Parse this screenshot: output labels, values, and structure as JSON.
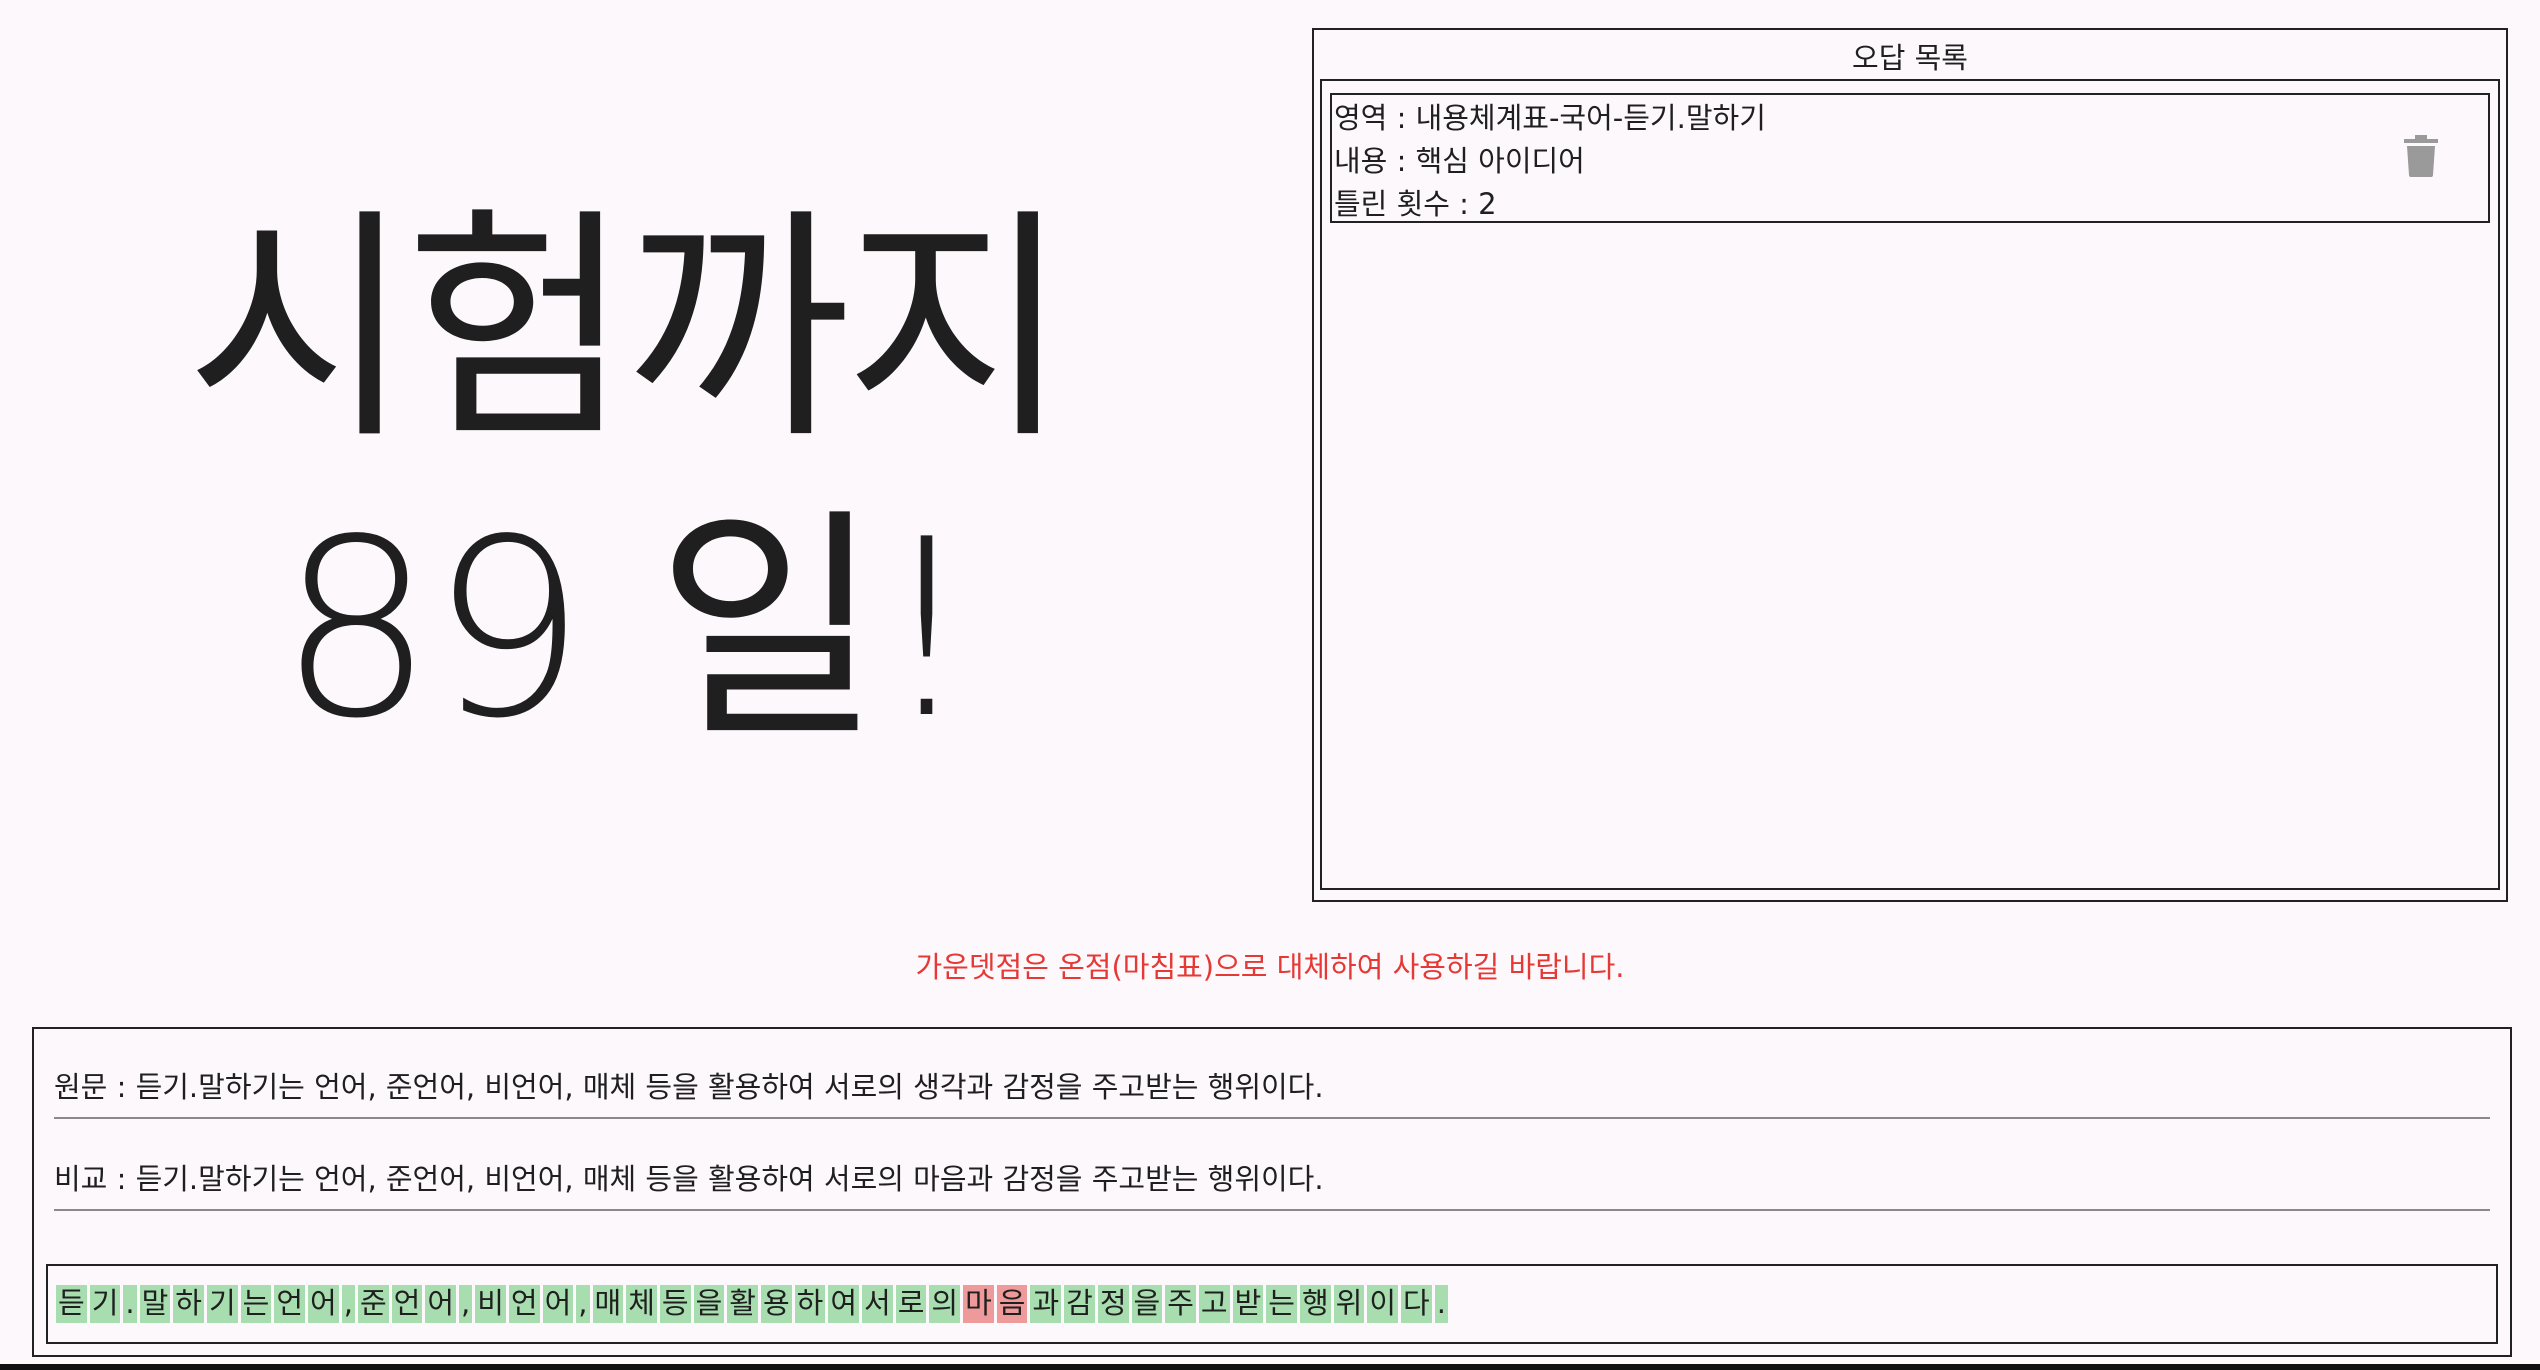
{
  "countdown": {
    "line1": "시험까지",
    "line2": "89 일!"
  },
  "wrong_answers": {
    "title": "오답 목록",
    "items": [
      {
        "area": "영역 : 내용체계표-국어-듣기.말하기",
        "content": "내용 : 핵심 아이디어",
        "wrong_count": "틀린 횟수 : 2",
        "delete_icon": "trash-icon"
      }
    ]
  },
  "notice": {
    "text": "가운뎃점은 온점(마침표)으로 대체하여 사용하길 바랍니다."
  },
  "compare": {
    "original": "원문 : 듣기.말하기는 언어, 준언어, 비언어, 매체 등을 활용하여 서로의 생각과 감정을 주고받는 행위이다.",
    "comparison": "비교 : 듣기.말하기는 언어, 준언어, 비언어, 매체 등을 활용하여 서로의 마음과 감정을 주고받는 행위이다.",
    "diff": [
      {
        "ch": "듣",
        "ok": true
      },
      {
        "ch": "기",
        "ok": true
      },
      {
        "ch": ".",
        "ok": true
      },
      {
        "ch": "말",
        "ok": true
      },
      {
        "ch": "하",
        "ok": true
      },
      {
        "ch": "기",
        "ok": true
      },
      {
        "ch": "는",
        "ok": true
      },
      {
        "ch": "언",
        "ok": true
      },
      {
        "ch": "어",
        "ok": true
      },
      {
        "ch": ",",
        "ok": true
      },
      {
        "ch": "준",
        "ok": true
      },
      {
        "ch": "언",
        "ok": true
      },
      {
        "ch": "어",
        "ok": true
      },
      {
        "ch": ",",
        "ok": true
      },
      {
        "ch": "비",
        "ok": true
      },
      {
        "ch": "언",
        "ok": true
      },
      {
        "ch": "어",
        "ok": true
      },
      {
        "ch": ",",
        "ok": true
      },
      {
        "ch": "매",
        "ok": true
      },
      {
        "ch": "체",
        "ok": true
      },
      {
        "ch": "등",
        "ok": true
      },
      {
        "ch": "을",
        "ok": true
      },
      {
        "ch": "활",
        "ok": true
      },
      {
        "ch": "용",
        "ok": true
      },
      {
        "ch": "하",
        "ok": true
      },
      {
        "ch": "여",
        "ok": true
      },
      {
        "ch": "서",
        "ok": true
      },
      {
        "ch": "로",
        "ok": true
      },
      {
        "ch": "의",
        "ok": true
      },
      {
        "ch": "마",
        "ok": false
      },
      {
        "ch": "음",
        "ok": false
      },
      {
        "ch": "과",
        "ok": true
      },
      {
        "ch": "감",
        "ok": true
      },
      {
        "ch": "정",
        "ok": true
      },
      {
        "ch": "을",
        "ok": true
      },
      {
        "ch": "주",
        "ok": true
      },
      {
        "ch": "고",
        "ok": true
      },
      {
        "ch": "받",
        "ok": true
      },
      {
        "ch": "는",
        "ok": true
      },
      {
        "ch": "행",
        "ok": true
      },
      {
        "ch": "위",
        "ok": true
      },
      {
        "ch": "이",
        "ok": true
      },
      {
        "ch": "다",
        "ok": true
      },
      {
        "ch": ".",
        "ok": true
      }
    ]
  },
  "colors": {
    "correct_bg": "#a8ddb0",
    "wrong_bg": "#ee9a9a",
    "notice": "#e53935",
    "background": "#fdf8fc"
  }
}
